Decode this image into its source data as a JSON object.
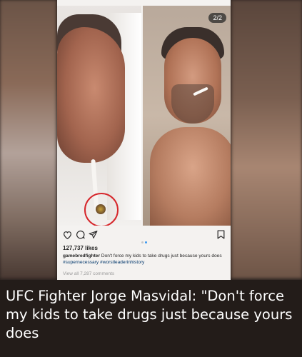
{
  "post": {
    "counter": "2/2",
    "likes": "127,737 likes",
    "username": "gamebredfighter",
    "caption_text": "Don't force my kids to take drugs just because yours does",
    "hashtags": "#supernecessary #worstleaderinhistory",
    "view_comments": "View all 7,287 comments",
    "icons": {
      "like": "heart-icon",
      "comment": "comment-icon",
      "share": "share-icon",
      "save": "bookmark-icon"
    },
    "carousel_active_color": "#3897f0"
  },
  "headline": {
    "text": "UFC Fighter Jorge Masvidal: \"Don't force my kids to take drugs just because yours does"
  }
}
